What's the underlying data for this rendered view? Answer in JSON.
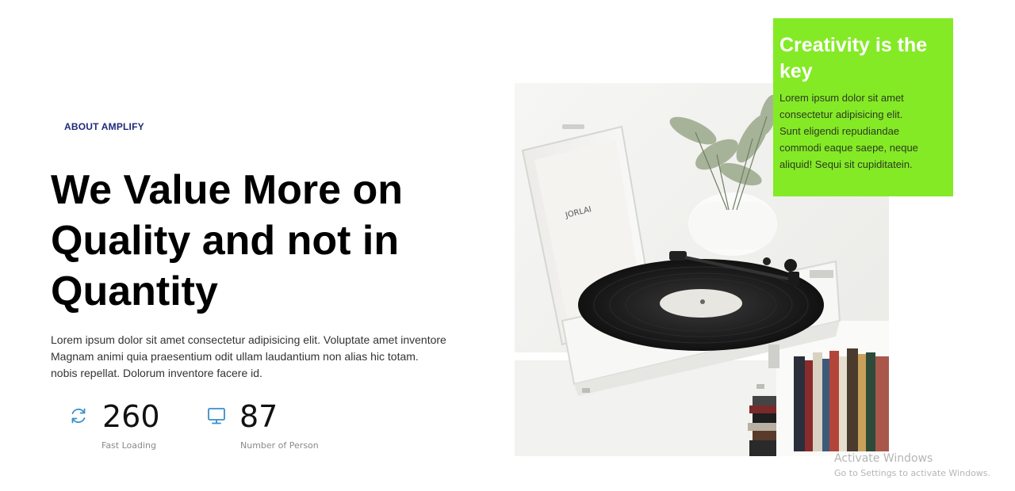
{
  "about": {
    "eyebrow": "ABOUT AMPLIFY",
    "headline_lines": [
      "We Value More on",
      "Quality and not in",
      "Quantity"
    ],
    "body_lines": [
      "Lorem ipsum dolor sit amet consectetur adipisicing elit. Voluptate amet inventore",
      "Magnam animi quia praesentium odit ullam laudantium non alias hic totam.",
      "nobis repellat. Dolorum inventore facere id."
    ]
  },
  "stats": [
    {
      "icon": "refresh-icon",
      "value": "260",
      "label": "Fast Loading"
    },
    {
      "icon": "monitor-icon",
      "value": "87",
      "label": "Number of Person"
    }
  ],
  "card": {
    "title_lines": [
      "Creativity is the",
      "key"
    ],
    "text_lines": [
      "Lorem ipsum dolor sit amet",
      "consectetur adipisicing elit.",
      "Sunt eligendi repudiandae",
      "commodi eaque saepe, neque",
      "aliquid! Sequi sit cupiditatein."
    ]
  },
  "photo": {
    "icon": "record-player-photo",
    "turntable_brand": "JORLAI"
  },
  "watermark": {
    "title": "Activate Windows",
    "subtitle": "Go to Settings to activate Windows."
  },
  "colors": {
    "card_background": "#84ea26",
    "eyebrow": "#1f2a7a",
    "stat_icon": "#3a8ec9"
  }
}
